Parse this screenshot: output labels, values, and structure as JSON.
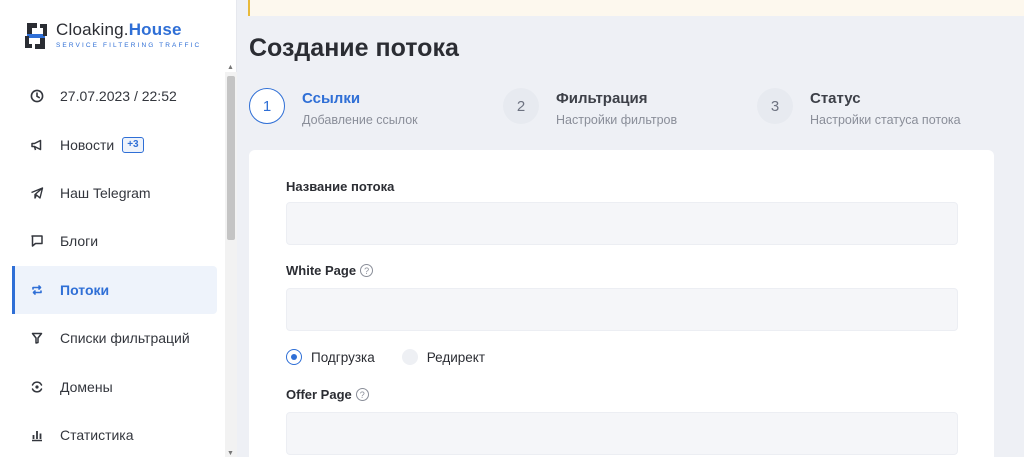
{
  "logo": {
    "name_part1": "Cloaking.",
    "name_part2": "House",
    "tagline": "SERVICE FILTERING TRAFFIC"
  },
  "sidebar": {
    "items": [
      {
        "label": "27.07.2023 / 22:52",
        "icon": "clock-icon"
      },
      {
        "label": "Новости",
        "icon": "megaphone-icon",
        "badge": "+3"
      },
      {
        "label": "Наш Telegram",
        "icon": "telegram-icon"
      },
      {
        "label": "Блоги",
        "icon": "chat-icon"
      },
      {
        "label": "Потоки",
        "icon": "repeat-icon",
        "active": true
      },
      {
        "label": "Списки фильтраций",
        "icon": "filter-icon"
      },
      {
        "label": "Домены",
        "icon": "domain-icon"
      },
      {
        "label": "Статистика",
        "icon": "bar-chart-icon"
      }
    ]
  },
  "page": {
    "title": "Создание потока"
  },
  "steps": [
    {
      "number": "1",
      "title": "Ссылки",
      "subtitle": "Добавление ссылок",
      "active": true
    },
    {
      "number": "2",
      "title": "Фильтрация",
      "subtitle": "Настройки фильтров"
    },
    {
      "number": "3",
      "title": "Статус",
      "subtitle": "Настройки статуса потока"
    }
  ],
  "form": {
    "stream_name_label": "Название потока",
    "stream_name_value": "",
    "white_page_label": "White Page",
    "white_page_value": "",
    "radio_options": [
      "Подгрузка",
      "Редирект"
    ],
    "selected_option": "Подгрузка",
    "offer_page_label": "Offer Page",
    "offer_page_value": "",
    "help_glyph": "?"
  },
  "colors": {
    "accent": "#2f6fd6",
    "notice_border": "#e8b93a",
    "background": "#eef0f5"
  }
}
